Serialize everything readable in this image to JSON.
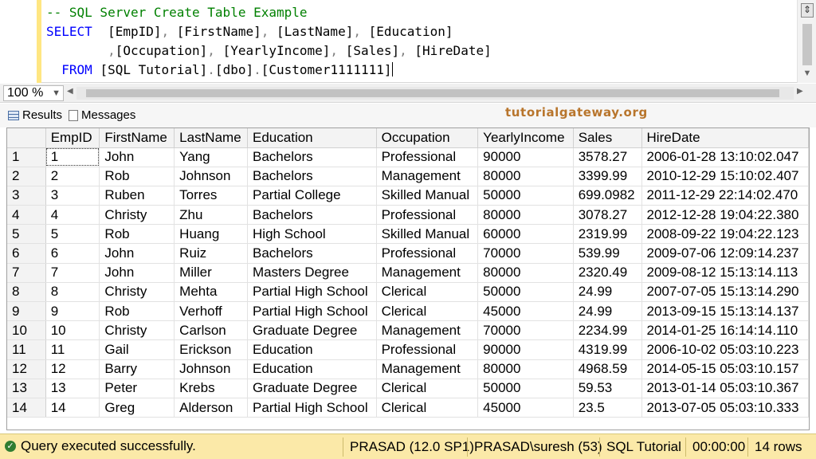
{
  "editor": {
    "comment": "-- SQL Server Create Table Example",
    "kw_select": "SELECT",
    "kw_from": "FROM",
    "line1_cols": [
      "[EmpID]",
      "[FirstName]",
      "[LastName]",
      "[Education]"
    ],
    "line2_cols": [
      "[Occupation]",
      "[YearlyIncome]",
      "[Sales]",
      "[HireDate]"
    ],
    "from_parts": [
      "[SQL Tutorial]",
      "[dbo]",
      "[Customer1111111]"
    ]
  },
  "zoom": {
    "value": "100 %"
  },
  "tabs": {
    "results": "Results",
    "messages": "Messages"
  },
  "watermark": "tutorialgateway.org",
  "grid": {
    "columns": [
      "EmpID",
      "FirstName",
      "LastName",
      "Education",
      "Occupation",
      "YearlyIncome",
      "Sales",
      "HireDate"
    ],
    "rows": [
      [
        "1",
        "1",
        "John",
        "Yang",
        "Bachelors",
        "Professional",
        "90000",
        "3578.27",
        "2006-01-28 13:10:02.047"
      ],
      [
        "2",
        "2",
        "Rob",
        "Johnson",
        "Bachelors",
        "Management",
        "80000",
        "3399.99",
        "2010-12-29 15:10:02.407"
      ],
      [
        "3",
        "3",
        "Ruben",
        "Torres",
        "Partial College",
        "Skilled Manual",
        "50000",
        "699.0982",
        "2011-12-29 22:14:02.470"
      ],
      [
        "4",
        "4",
        "Christy",
        "Zhu",
        "Bachelors",
        "Professional",
        "80000",
        "3078.27",
        "2012-12-28 19:04:22.380"
      ],
      [
        "5",
        "5",
        "Rob",
        "Huang",
        "High School",
        "Skilled Manual",
        "60000",
        "2319.99",
        "2008-09-22 19:04:22.123"
      ],
      [
        "6",
        "6",
        "John",
        "Ruiz",
        "Bachelors",
        "Professional",
        "70000",
        "539.99",
        "2009-07-06 12:09:14.237"
      ],
      [
        "7",
        "7",
        "John",
        "Miller",
        "Masters Degree",
        "Management",
        "80000",
        "2320.49",
        "2009-08-12 15:13:14.113"
      ],
      [
        "8",
        "8",
        "Christy",
        "Mehta",
        "Partial High School",
        "Clerical",
        "50000",
        "24.99",
        "2007-07-05 15:13:14.290"
      ],
      [
        "9",
        "9",
        "Rob",
        "Verhoff",
        "Partial High School",
        "Clerical",
        "45000",
        "24.99",
        "2013-09-15 15:13:14.137"
      ],
      [
        "10",
        "10",
        "Christy",
        "Carlson",
        "Graduate Degree",
        "Management",
        "70000",
        "2234.99",
        "2014-01-25 16:14:14.110"
      ],
      [
        "11",
        "11",
        "Gail",
        "Erickson",
        "Education",
        "Professional",
        "90000",
        "4319.99",
        "2006-10-02 05:03:10.223"
      ],
      [
        "12",
        "12",
        "Barry",
        "Johnson",
        "Education",
        "Management",
        "80000",
        "4968.59",
        "2014-05-15 05:03:10.157"
      ],
      [
        "13",
        "13",
        "Peter",
        "Krebs",
        "Graduate Degree",
        "Clerical",
        "50000",
        "59.53",
        "2013-01-14 05:03:10.367"
      ],
      [
        "14",
        "14",
        "Greg",
        "Alderson",
        "Partial High School",
        "Clerical",
        "45000",
        "23.5",
        "2013-07-05 05:03:10.333"
      ]
    ]
  },
  "status": {
    "message": "Query executed successfully.",
    "server": "PRASAD (12.0 SP1)",
    "user": "PRASAD\\suresh (53)",
    "database": "SQL Tutorial",
    "elapsed": "00:00:00",
    "rows": "14 rows"
  },
  "colors": {
    "status_bg": "#fbe9a8",
    "keyword": "#0000ff",
    "comment": "#008000",
    "watermark": "#b8752c"
  }
}
